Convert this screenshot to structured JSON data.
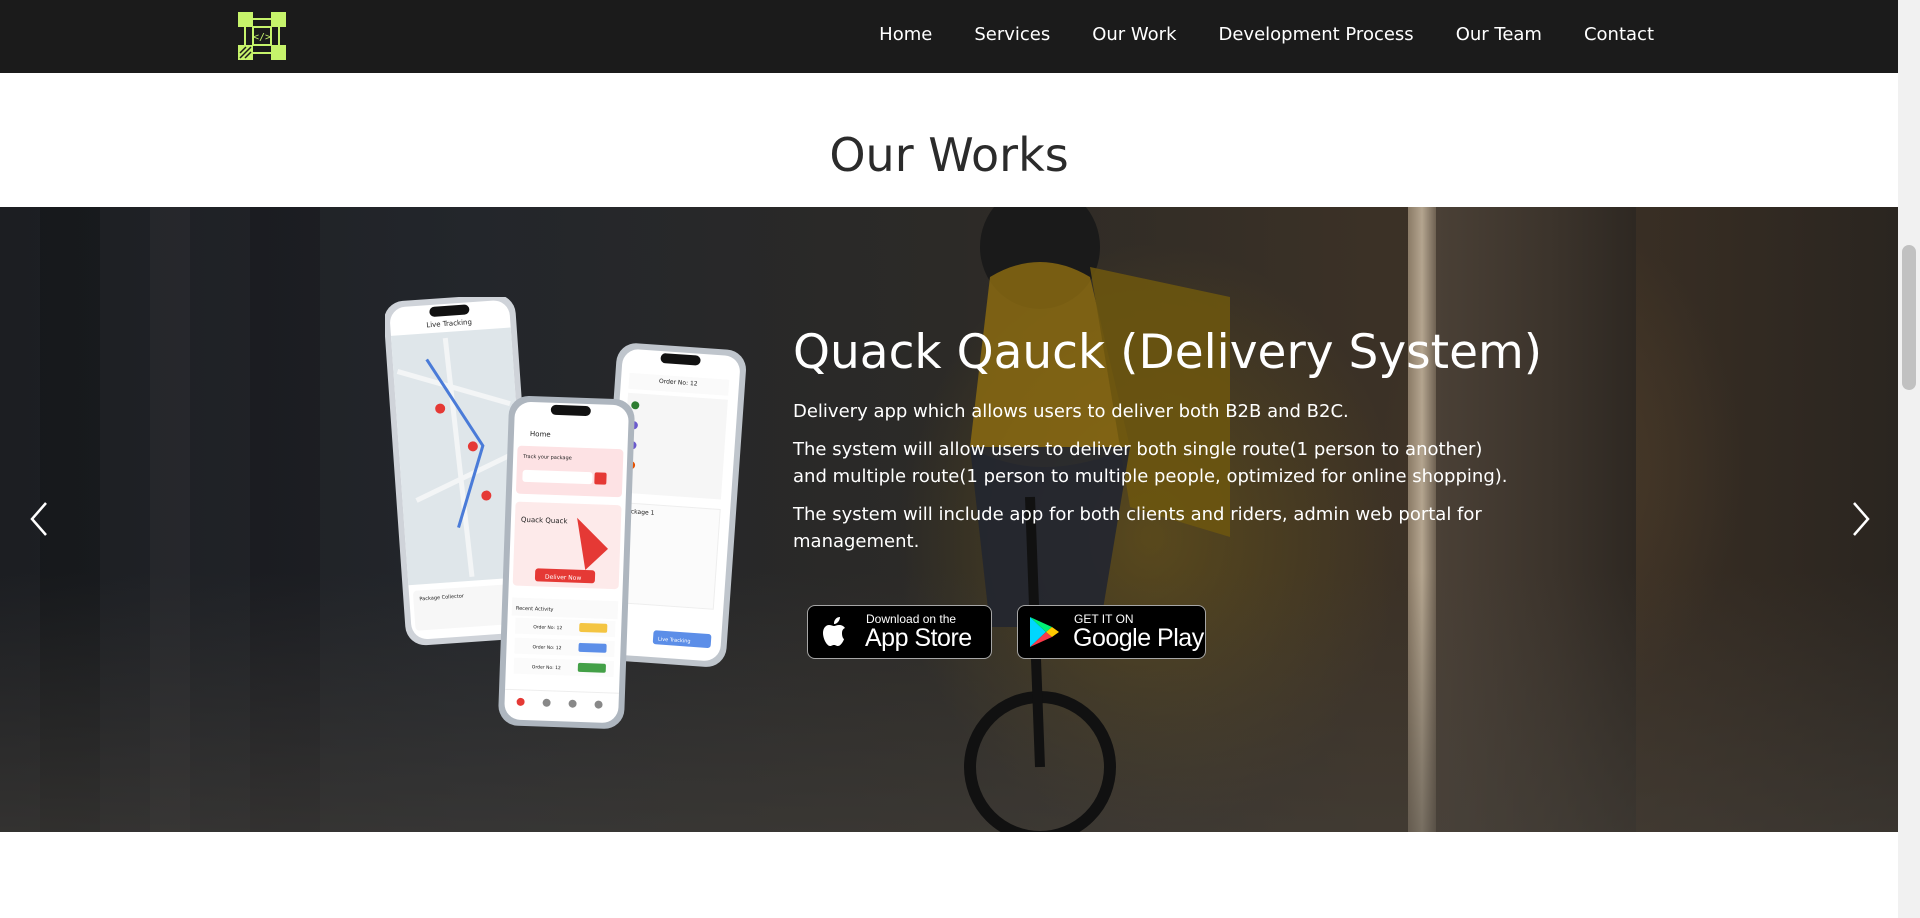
{
  "nav": {
    "links": [
      "Home",
      "Services",
      "Our Work",
      "Development Process",
      "Our Team",
      "Contact"
    ],
    "logo_icon": "code-brackets-icon"
  },
  "section": {
    "title": "Our Works"
  },
  "slide": {
    "title": "Quack Qauck (Delivery System)",
    "paragraphs": [
      "Delivery app which allows users to deliver both B2B and B2C.",
      "The system will allow users to deliver both single route(1 person to another) and multiple route(1 person to multiple people, optimized for online shopping).",
      "The system will include app for both clients and riders, admin web portal for management."
    ],
    "app_store": {
      "small": "Download on the",
      "big": "App Store"
    },
    "google_play": {
      "small": "GET IT ON",
      "big": "Google Play"
    }
  },
  "phones": {
    "left": {
      "title": "Live Tracking",
      "footer": "Package Collector"
    },
    "center": {
      "header": "Home",
      "track_label": "Track your package",
      "brand": "Quack Quack",
      "cta": "Deliver Now",
      "recent": "Recent Activity",
      "orders": [
        "Order No: 12",
        "Order No: 12",
        "Order No: 12"
      ]
    },
    "right": {
      "header": "Order No: 12",
      "package": "Package 1",
      "button": "Live Tracking"
    }
  },
  "colors": {
    "navbar_bg": "#1b1b1b",
    "logo_green": "#c6f36b",
    "heading_text": "#2b2b2b",
    "accent_red": "#e53935"
  }
}
